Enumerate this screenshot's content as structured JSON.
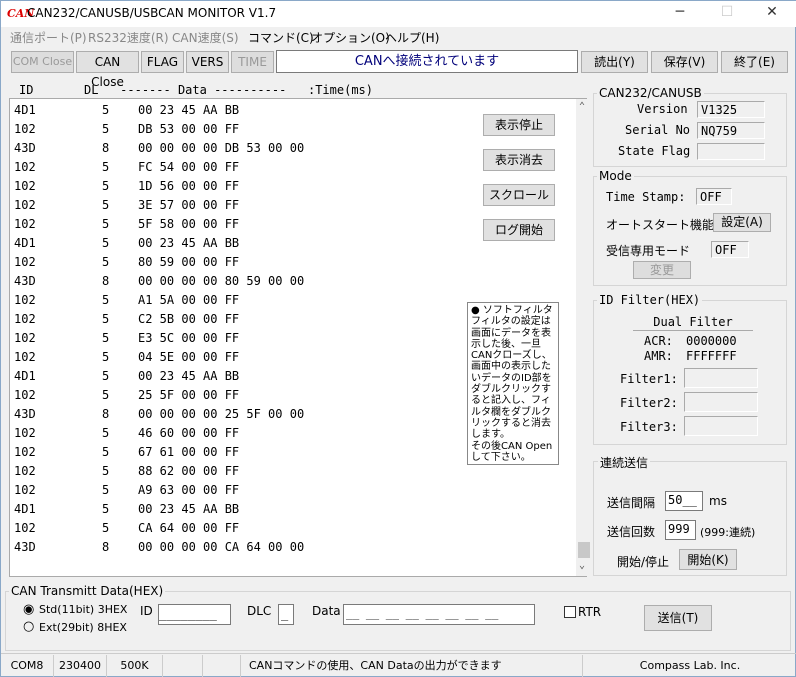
{
  "window": {
    "logo": "CAN",
    "title": "CAN232/CANUSB/USBCAN MONITOR V1.7",
    "minimize": "─",
    "maximize": "☐",
    "close": "✕"
  },
  "menu": [
    {
      "label": "通信ポート(P)",
      "enabled": false
    },
    {
      "label": "RS232速度(R)",
      "enabled": false
    },
    {
      "label": "CAN速度(S)",
      "enabled": false
    },
    {
      "label": "コマンド(C)",
      "enabled": true
    },
    {
      "label": "オプション(O)",
      "enabled": true
    },
    {
      "label": "ヘルプ(H)",
      "enabled": true
    }
  ],
  "toolbar": {
    "com_close": "COM Close",
    "can_close": "CAN Close",
    "flag": "FLAG",
    "vers": "VERS",
    "time": "TIME",
    "status": "CANへ接続されています",
    "read": "読出(Y)",
    "save": "保存(V)",
    "exit": "終了(E)"
  },
  "log": {
    "header": "ID       DL   ------- Data ----------   :Time(ms)",
    "rows": [
      [
        "4D1",
        "5",
        "00 23 45 AA BB"
      ],
      [
        "102",
        "5",
        "DB 53 00 00 FF"
      ],
      [
        "43D",
        "8",
        "00 00 00 00 DB 53 00 00"
      ],
      [
        "102",
        "5",
        "FC 54 00 00 FF"
      ],
      [
        "102",
        "5",
        "1D 56 00 00 FF"
      ],
      [
        "102",
        "5",
        "3E 57 00 00 FF"
      ],
      [
        "102",
        "5",
        "5F 58 00 00 FF"
      ],
      [
        "4D1",
        "5",
        "00 23 45 AA BB"
      ],
      [
        "102",
        "5",
        "80 59 00 00 FF"
      ],
      [
        "43D",
        "8",
        "00 00 00 00 80 59 00 00"
      ],
      [
        "102",
        "5",
        "A1 5A 00 00 FF"
      ],
      [
        "102",
        "5",
        "C2 5B 00 00 FF"
      ],
      [
        "102",
        "5",
        "E3 5C 00 00 FF"
      ],
      [
        "102",
        "5",
        "04 5E 00 00 FF"
      ],
      [
        "4D1",
        "5",
        "00 23 45 AA BB"
      ],
      [
        "102",
        "5",
        "25 5F 00 00 FF"
      ],
      [
        "43D",
        "8",
        "00 00 00 00 25 5F 00 00"
      ],
      [
        "102",
        "5",
        "46 60 00 00 FF"
      ],
      [
        "102",
        "5",
        "67 61 00 00 FF"
      ],
      [
        "102",
        "5",
        "88 62 00 00 FF"
      ],
      [
        "102",
        "5",
        "A9 63 00 00 FF"
      ],
      [
        "4D1",
        "5",
        "00 23 45 AA BB"
      ],
      [
        "102",
        "5",
        "CA 64 00 00 FF"
      ],
      [
        "43D",
        "8",
        "00 00 00 00 CA 64 00 00"
      ]
    ],
    "buttons": [
      "表示停止",
      "表示消去",
      "スクロール",
      "ログ開始"
    ],
    "note": "● ソフトフィルタ\nフィルタの設定は画面にデータを表示した後、一旦CANクローズし、画面中の表示したいデータのID部をダブルクリックすると記入し、フィルタ欄をダブルクリックすると消去します。\nその後CAN Open して下さい。"
  },
  "device": {
    "title": "CAN232/CANUSB",
    "version_label": "Version",
    "version": "V1325",
    "serial_label": "Serial No",
    "serial": "NQ759",
    "state_label": "State Flag",
    "state": ""
  },
  "mode": {
    "title": "Mode",
    "timestamp_label": "Time Stamp:",
    "timestamp": "OFF",
    "autostart_label": "オートスタート機能",
    "autostart_button": "設定(A)",
    "listen_label": "受信専用モード",
    "listen": "OFF",
    "change_button": "変更"
  },
  "filter": {
    "title": "ID Filter(HEX)",
    "mode": "Dual Filter",
    "acr_label": "ACR:",
    "acr": "0000000",
    "amr_label": "AMR:",
    "amr": "FFFFFFF",
    "f1": "Filter1:",
    "f2": "Filter2:",
    "f3": "Filter3:"
  },
  "continuous": {
    "title": "連続送信",
    "interval_label": "送信間隔",
    "interval": "50__",
    "interval_unit": "ms",
    "count_label": "送信回数",
    "count": "999",
    "count_note": "(999:連続)",
    "startstop_label": "開始/停止",
    "start_button": "開始(K)"
  },
  "transmit": {
    "title": "CAN Transmitt Data(HEX)",
    "std": "Std(11bit) 3HEX",
    "ext": "Ext(29bit) 8HEX",
    "std_selected": true,
    "id_label": "ID",
    "id": "________",
    "dlc_label": "DLC",
    "dlc": "_",
    "data_label": "Data",
    "data": "__ __ __ __ __ __ __ __",
    "rtr": "RTR",
    "rtr_checked": false,
    "send": "送信(T)"
  },
  "statusbar": {
    "port": "COM8",
    "baud": "230400",
    "can_speed": "500K",
    "message": "CANコマンドの使用、CAN Dataの出力ができます",
    "company": "Compass Lab. Inc."
  }
}
